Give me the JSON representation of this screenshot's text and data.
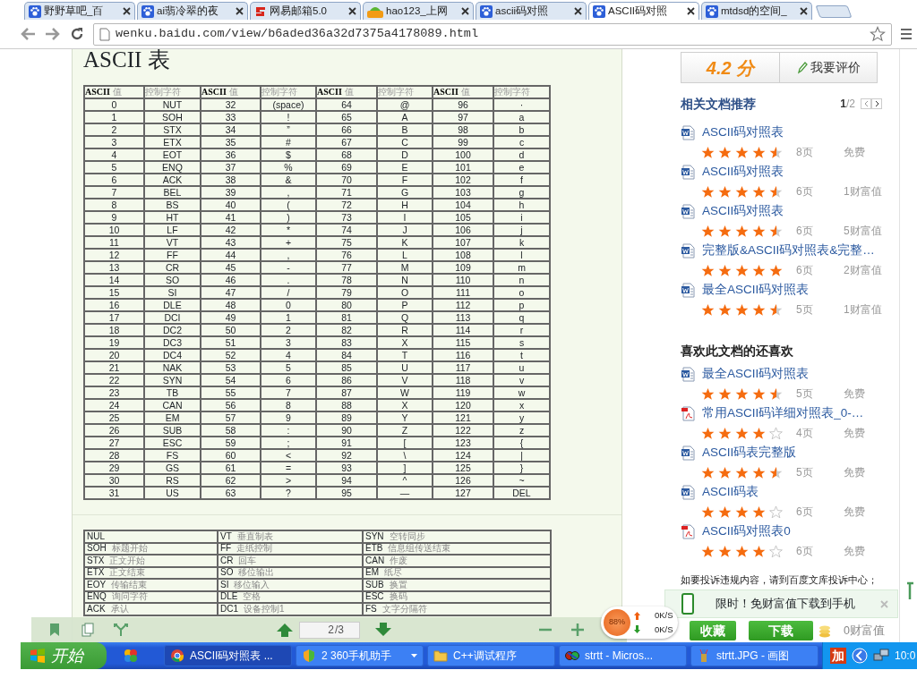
{
  "browser": {
    "tabs": [
      {
        "title": "野野草吧_百",
        "kind": "paw",
        "selected": false
      },
      {
        "title": "ai翡冷翠的夜",
        "kind": "paw",
        "selected": false
      },
      {
        "title": "网易邮箱5.0",
        "kind": "mail",
        "selected": false
      },
      {
        "title": "hao123_上网",
        "kind": "hao",
        "selected": false
      },
      {
        "title": "ascii码对照",
        "kind": "paw",
        "selected": false
      },
      {
        "title": "ASCII码对照",
        "kind": "paw",
        "selected": true
      },
      {
        "title": "mtdsd的空间_",
        "kind": "paw",
        "selected": false
      }
    ],
    "address": "wenku.baidu.com/view/b6aded36a32d7375a4178089.html"
  },
  "document": {
    "title": "ASCII 表",
    "ascii_table": {
      "columns": [
        "**ASCII** 值",
        "控制字符",
        "**ASCII** 值",
        "控制字符",
        "**ASCII** 值",
        "控制字符",
        "**ASCII** 值",
        "控制字符"
      ],
      "rows": [
        [
          "0",
          "NUT",
          "32",
          "(space)",
          "64",
          "@",
          "96",
          "·"
        ],
        [
          "1",
          "SOH",
          "33",
          "!",
          "65",
          "A",
          "97",
          "a"
        ],
        [
          "2",
          "STX",
          "34",
          "”",
          "66",
          "B",
          "98",
          "b"
        ],
        [
          "3",
          "ETX",
          "35",
          "#",
          "67",
          "C",
          "99",
          "c"
        ],
        [
          "4",
          "EOT",
          "36",
          "$",
          "68",
          "D",
          "100",
          "d"
        ],
        [
          "5",
          "ENQ",
          "37",
          "%",
          "69",
          "E",
          "101",
          "e"
        ],
        [
          "6",
          "ACK",
          "38",
          "&",
          "70",
          "F",
          "102",
          "f"
        ],
        [
          "7",
          "BEL",
          "39",
          ",",
          "71",
          "G",
          "103",
          "g"
        ],
        [
          "8",
          "BS",
          "40",
          "(",
          "72",
          "H",
          "104",
          "h"
        ],
        [
          "9",
          "HT",
          "41",
          ")",
          "73",
          "I",
          "105",
          "i"
        ],
        [
          "10",
          "LF",
          "42",
          "*",
          "74",
          "J",
          "106",
          "j"
        ],
        [
          "11",
          "VT",
          "43",
          "+",
          "75",
          "K",
          "107",
          "k"
        ],
        [
          "12",
          "FF",
          "44",
          ",",
          "76",
          "L",
          "108",
          "l"
        ],
        [
          "13",
          "CR",
          "45",
          "-",
          "77",
          "M",
          "109",
          "m"
        ],
        [
          "14",
          "SO",
          "46",
          ".",
          "78",
          "N",
          "110",
          "n"
        ],
        [
          "15",
          "SI",
          "47",
          "/",
          "79",
          "O",
          "111",
          "o"
        ],
        [
          "16",
          "DLE",
          "48",
          "0",
          "80",
          "P",
          "112",
          "p"
        ],
        [
          "17",
          "DCI",
          "49",
          "1",
          "81",
          "Q",
          "113",
          "q"
        ],
        [
          "18",
          "DC2",
          "50",
          "2",
          "82",
          "R",
          "114",
          "r"
        ],
        [
          "19",
          "DC3",
          "51",
          "3",
          "83",
          "X",
          "115",
          "s"
        ],
        [
          "20",
          "DC4",
          "52",
          "4",
          "84",
          "T",
          "116",
          "t"
        ],
        [
          "21",
          "NAK",
          "53",
          "5",
          "85",
          "U",
          "117",
          "u"
        ],
        [
          "22",
          "SYN",
          "54",
          "6",
          "86",
          "V",
          "118",
          "v"
        ],
        [
          "23",
          "TB",
          "55",
          "7",
          "87",
          "W",
          "119",
          "w"
        ],
        [
          "24",
          "CAN",
          "56",
          "8",
          "88",
          "X",
          "120",
          "x"
        ],
        [
          "25",
          "EM",
          "57",
          "9",
          "89",
          "Y",
          "121",
          "y"
        ],
        [
          "26",
          "SUB",
          "58",
          ":",
          "90",
          "Z",
          "122",
          "z"
        ],
        [
          "27",
          "ESC",
          "59",
          ";",
          "91",
          "[",
          "123",
          "{"
        ],
        [
          "28",
          "FS",
          "60",
          "<",
          "92",
          "\\",
          "124",
          "|"
        ],
        [
          "29",
          "GS",
          "61",
          "=",
          "93",
          "]",
          "125",
          "}"
        ],
        [
          "30",
          "RS",
          "62",
          ">",
          "94",
          "^",
          "126",
          "~"
        ],
        [
          "31",
          "US",
          "63",
          "?",
          "95",
          "—",
          "127",
          "DEL"
        ]
      ]
    },
    "legend_rows": [
      [
        {
          "code": "NUL"
        },
        {
          "code": "VT",
          "meaning": "垂直制表"
        },
        {
          "code": "SYN",
          "meaning": "空转同步"
        }
      ],
      [
        {
          "code": "SOH",
          "meaning": "标题开始"
        },
        {
          "code": "FF",
          "meaning": "走纸控制"
        },
        {
          "code": "ETB",
          "meaning": "信息组传送结束"
        }
      ],
      [
        {
          "code": "STX",
          "meaning": "正文开始"
        },
        {
          "code": "CR",
          "meaning": "回车"
        },
        {
          "code": "CAN",
          "meaning": "作废"
        }
      ],
      [
        {
          "code": "ETX",
          "meaning": "正文结束"
        },
        {
          "code": "SO",
          "meaning": "移位输出"
        },
        {
          "code": "EM",
          "meaning": "纸尽"
        }
      ],
      [
        {
          "code": "EOY",
          "meaning": "传输结束"
        },
        {
          "code": "SI",
          "meaning": "移位输入"
        },
        {
          "code": "SUB",
          "meaning": "换置"
        }
      ],
      [
        {
          "code": "ENQ",
          "meaning": "询问字符"
        },
        {
          "code": "DLE",
          "meaning": "空格"
        },
        {
          "code": "ESC",
          "meaning": "换码"
        }
      ],
      [
        {
          "code": "ACK",
          "meaning": "承认"
        },
        {
          "code": "DC1",
          "meaning": "设备控制1"
        },
        {
          "code": "FS",
          "meaning": "文字分隔符"
        }
      ]
    ]
  },
  "viewer_toolbar": {
    "page": "2",
    "total": "/3"
  },
  "net_widget": {
    "percent": "88%",
    "upload": "0K/S",
    "download": "0K/S"
  },
  "sidebar": {
    "rating": "4.2 分",
    "rate_button": "我要评价",
    "related": {
      "title": "相关文档推荐",
      "pager": "**1**/2",
      "items": [
        {
          "kind": "word",
          "title": "ASCII码对照表",
          "stars": 4.5,
          "pages": "8页",
          "price": "免费"
        },
        {
          "kind": "word",
          "title": "ASCII码对照表",
          "stars": 4.5,
          "pages": "6页",
          "price": "1财富值"
        },
        {
          "kind": "word",
          "title": "ASCII码对照表",
          "stars": 4.5,
          "pages": "6页",
          "price": "5财富值"
        },
        {
          "kind": "word",
          "title": "完整版&ASCII码对照表&完整…",
          "stars": 5,
          "pages": "6页",
          "price": "2财富值"
        },
        {
          "kind": "word",
          "title": "最全ASCII码对照表",
          "stars": 4.5,
          "pages": "5页",
          "price": "1财富值"
        }
      ]
    },
    "also_liked": {
      "title": "喜欢此文档的还喜欢",
      "items": [
        {
          "kind": "word",
          "title": "最全ASCII码对照表",
          "stars": 4.5,
          "pages": "5页",
          "price": "免费"
        },
        {
          "kind": "pdf",
          "title": "常用ASCII码详细对照表_0-…",
          "stars": 4,
          "pages": "4页",
          "price": "免费"
        },
        {
          "kind": "word",
          "title": "ASCII码表完整版",
          "stars": 4.5,
          "pages": "5页",
          "price": "免费"
        },
        {
          "kind": "word",
          "title": "ASCII码表",
          "stars": 4,
          "pages": "6页",
          "price": "免费"
        },
        {
          "kind": "pdf",
          "title": "ASCII码对照表0",
          "stars": 4,
          "pages": "6页",
          "price": "免费"
        }
      ]
    },
    "report": {
      "text": "如要投诉违规内容，请到",
      "link": "百度文库投诉中心",
      "end": "；"
    },
    "promo": {
      "link": "限时！免财富值下载到手机"
    },
    "buttons": {
      "collect": "收藏",
      "download": "下载",
      "cost": "0财富值"
    }
  },
  "taskbar": {
    "start": "开始",
    "tasks": [
      {
        "label": "ASCII码对照表 ...",
        "kind": "chrome",
        "selected": true,
        "menu": false
      },
      {
        "label": "2 360手机助手",
        "kind": "shield",
        "selected": false,
        "menu": true
      },
      {
        "label": "C++调试程序",
        "kind": "folder",
        "selected": false,
        "menu": false
      },
      {
        "label": "strtt - Micros...",
        "kind": "vs",
        "selected": false,
        "menu": false
      },
      {
        "label": "strtt.JPG - 画图",
        "kind": "paint",
        "selected": false,
        "menu": false
      }
    ],
    "tray_badge": "加",
    "clock": "10:0"
  }
}
